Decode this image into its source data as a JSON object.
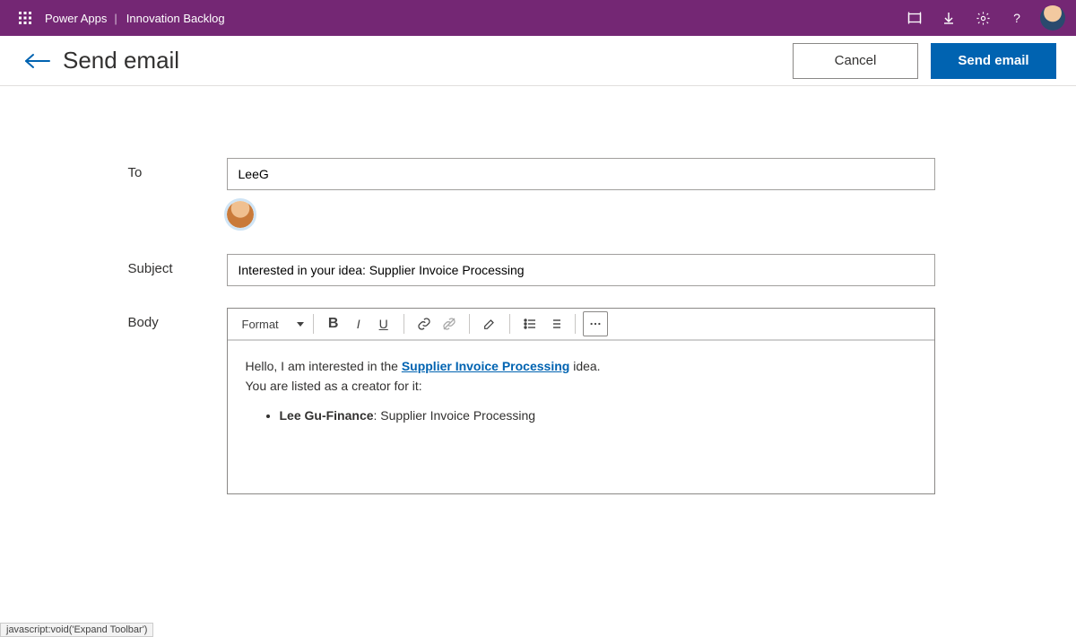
{
  "topbar": {
    "product": "Power Apps",
    "apptitle": "Innovation Backlog"
  },
  "header": {
    "title": "Send email",
    "cancel": "Cancel",
    "send": "Send email"
  },
  "form": {
    "labels": {
      "to": "To",
      "subject": "Subject",
      "body": "Body"
    },
    "to_value": "LeeG",
    "subject_value": "Interested in your idea: Supplier Invoice Processing"
  },
  "toolbar": {
    "format": "Format"
  },
  "body": {
    "line1_pre": "Hello, I am interested in the ",
    "link": "Supplier Invoice Processing",
    "line1_post": " idea.",
    "line2": "You are listed as a creator for it:",
    "bullet_bold": "Lee Gu-Finance",
    "bullet_rest": ": Supplier Invoice Processing"
  },
  "status": "javascript:void('Expand Toolbar')"
}
